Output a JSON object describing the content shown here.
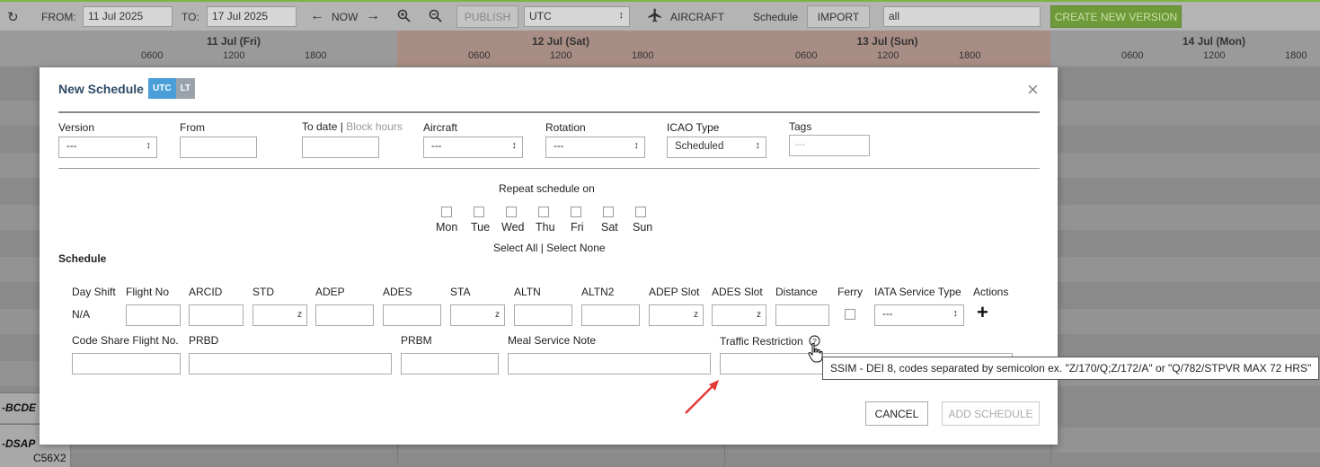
{
  "toolbar": {
    "from_label": "FROM:",
    "from_value": "11 Jul 2025",
    "to_label": "TO:",
    "to_value": "17 Jul 2025",
    "now_label": "NOW",
    "publish_label": "PUBLISH",
    "timezone": "UTC",
    "aircraft_label": "AIRCRAFT",
    "schedule_label": "Schedule",
    "import_label": "IMPORT",
    "filter_value": "all",
    "create_version_label": "CREATE NEW VERSION"
  },
  "timeline": {
    "days": [
      {
        "label": "11 Jul (Fri)",
        "hours": [
          "0600",
          "1200",
          "1800"
        ]
      },
      {
        "label": "12 Jul (Sat)",
        "hours": [
          "0600",
          "1200",
          "1800"
        ]
      },
      {
        "label": "13 Jul (Sun)",
        "hours": [
          "0600",
          "1200",
          "1800"
        ]
      },
      {
        "label": "14 Jul (Mon)",
        "hours": [
          "0600",
          "1200",
          "1800"
        ]
      }
    ]
  },
  "background_rows": [
    {
      "registration": "-BCDE"
    },
    {
      "registration": "-DSAP",
      "type": "C56X2"
    }
  ],
  "modal": {
    "title": "New Schedule",
    "utc_toggle": "UTC",
    "lt_toggle": "LT",
    "close": "×",
    "version_label": "Version",
    "version_value": "---",
    "from_label": "From",
    "todate_label": "To date",
    "todate_sep": "|",
    "blockhours_label": "Block hours",
    "aircraft_label": "Aircraft",
    "aircraft_value": "---",
    "rotation_label": "Rotation",
    "rotation_value": "---",
    "icao_label": "ICAO Type",
    "icao_value": "Scheduled",
    "tags_label": "Tags",
    "tags_placeholder": "---",
    "repeat_label": "Repeat schedule on",
    "days": [
      "Mon",
      "Tue",
      "Wed",
      "Thu",
      "Fri",
      "Sat",
      "Sun"
    ],
    "select_all": "Select All",
    "select_sep": "|",
    "select_none": "Select None",
    "schedule_heading": "Schedule",
    "columns": {
      "day_shift": "Day Shift",
      "flight_no": "Flight No",
      "arcid": "ARCID",
      "std": "STD",
      "adep": "ADEP",
      "ades": "ADES",
      "sta": "STA",
      "altn": "ALTN",
      "altn2": "ALTN2",
      "adep_slot": "ADEP Slot",
      "ades_slot": "ADES Slot",
      "distance": "Distance",
      "ferry": "Ferry",
      "iata_service": "IATA Service Type",
      "actions": "Actions"
    },
    "day_shift_value": "N/A",
    "zulu": "z",
    "iata_value": "---",
    "add_icon": "+",
    "codeshare_label": "Code Share Flight No.",
    "prbd_label": "PRBD",
    "prbm_label": "PRBM",
    "meal_label": "Meal Service Note",
    "traffic_label": "Traffic Restriction",
    "cancel_label": "CANCEL",
    "add_schedule_label": "ADD SCHEDULE"
  },
  "tooltip": "SSIM - DEI 8, codes separated by semicolon ex. \"Z/170/Q;Z/172/A\" or \"Q/782/STPVR MAX 72 HRS\"",
  "colors": {
    "accent_green": "#7cb342",
    "utc_blue": "#4a9fd8",
    "arrow_red": "#e53935",
    "title_blue": "#2e4a66"
  }
}
